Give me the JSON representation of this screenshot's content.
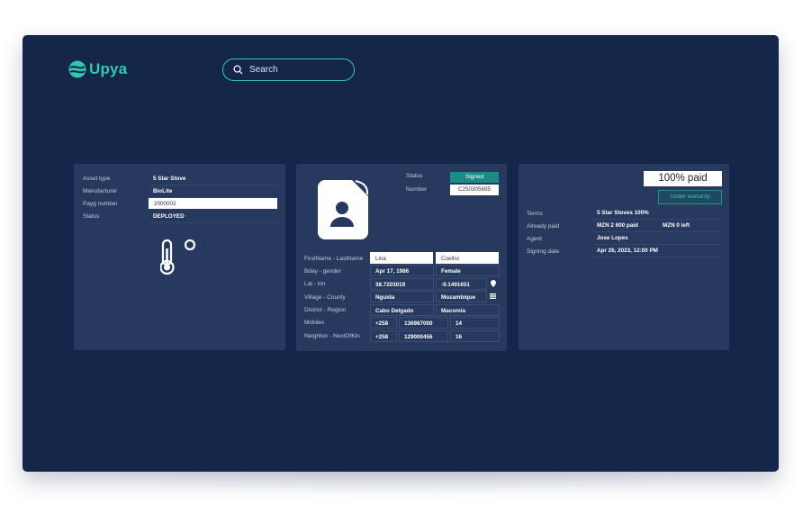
{
  "brand": {
    "name": "Upya",
    "accent": "#33c7ad",
    "background": "#14264a",
    "card": "#27395e"
  },
  "search": {
    "placeholder": "Search",
    "icon": "search-icon"
  },
  "asset": {
    "rows": [
      {
        "label": "Asset type",
        "value": "5 Star Stove"
      },
      {
        "label": "Manufacturer",
        "value": "BioLite"
      },
      {
        "label": "Payg number",
        "value": "2000002"
      },
      {
        "label": "Status",
        "value": "DEPLOYED"
      }
    ],
    "icon": "thermometer-icon"
  },
  "client": {
    "status_label": "Status",
    "status_value": "Signed",
    "status_color": "#1e8a86",
    "number_label": "Number",
    "number_value": "C250305695",
    "avatar_icon": "user-file-icon",
    "rows": [
      {
        "label": "FirstName - LastName",
        "a": "Lina",
        "b": "Coelho"
      },
      {
        "label": "Bday - gender",
        "a": "Apr 17, 1986",
        "b": "Female"
      },
      {
        "label": "Lat - lon",
        "a": "38.7203019",
        "b": "-9.1491651"
      },
      {
        "label": "Village - County",
        "a": "Nguida",
        "b": "Mozambique"
      },
      {
        "label": "District - Region",
        "a": "Cabo Delgado",
        "b": "Macomia"
      },
      {
        "label": "Mobiles",
        "a": "+258",
        "b": "136987000",
        "c": "14"
      },
      {
        "label": "Neighbor - NextOfKin",
        "a": "+258",
        "b": "129000456",
        "c": "16"
      }
    ]
  },
  "contract": {
    "paid": "100% paid",
    "warranty": "Under warranty",
    "rows": [
      {
        "label": "Terms",
        "value": "5 Star Stoves 100%"
      },
      {
        "label": "Already paid",
        "value": "MZN 2 600 paid",
        "extra": "MZN 0 left"
      },
      {
        "label": "Agent",
        "value": "Jose Lopes"
      },
      {
        "label": "Signing date",
        "value": "Apr 26, 2023, 12:00 PM"
      }
    ]
  }
}
